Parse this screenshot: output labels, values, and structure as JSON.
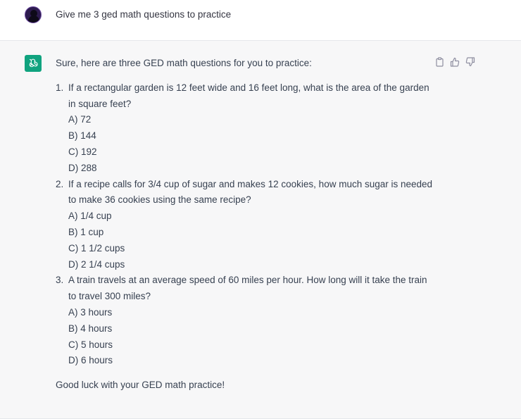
{
  "user_message": {
    "text": "Give me 3 ged math questions to practice"
  },
  "assistant_message": {
    "intro": "Sure, here are three GED math questions for you to practice:",
    "questions": [
      {
        "number": "1.",
        "text": "If a rectangular garden is 12 feet wide and 16 feet long, what is the area of the garden in square feet?",
        "options": [
          "A) 72",
          "B) 144",
          "C) 192",
          "D) 288"
        ]
      },
      {
        "number": "2.",
        "text": "If a recipe calls for 3/4 cup of sugar and makes 12 cookies, how much sugar is needed to make 36 cookies using the same recipe?",
        "options": [
          "A) 1/4 cup",
          "B) 1 cup",
          "C) 1 1/2 cups",
          "D) 2 1/4 cups"
        ]
      },
      {
        "number": "3.",
        "text": "A train travels at an average speed of 60 miles per hour. How long will it take the train to travel 300 miles?",
        "options": [
          "A) 3 hours",
          "B) 4 hours",
          "C) 5 hours",
          "D) 6 hours"
        ]
      }
    ],
    "outro": "Good luck with your GED math practice!"
  },
  "icons": {
    "user_avatar": "user-avatar-icon",
    "bot_avatar": "openai-logo-icon",
    "copy": "clipboard-icon",
    "thumbs_up": "thumbs-up-icon",
    "thumbs_down": "thumbs-down-icon"
  },
  "colors": {
    "bot_avatar_bg": "#10a37f",
    "assistant_bg": "#f7f7f8",
    "text": "#374151"
  }
}
